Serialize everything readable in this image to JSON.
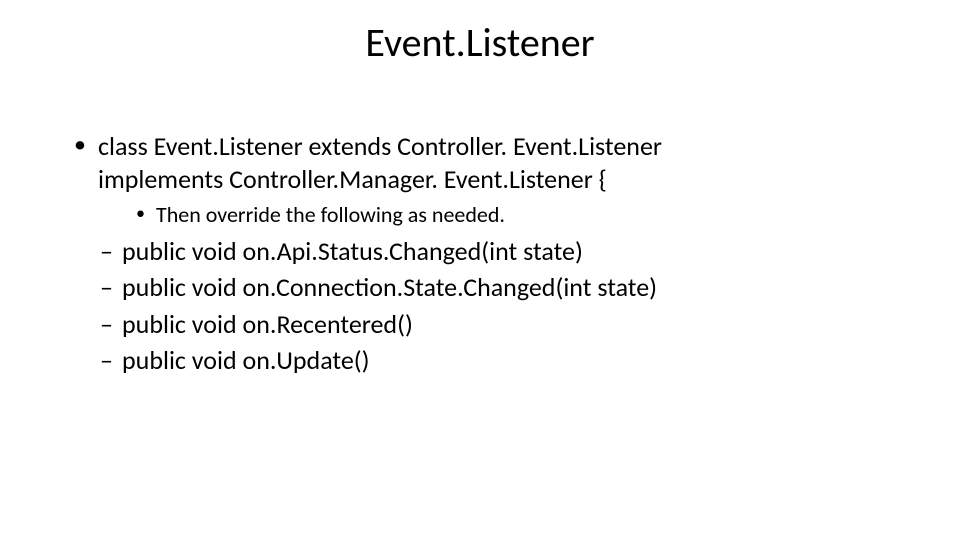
{
  "title": "Event.Listener",
  "bullet1_line1": "class Event.Listener extends Controller. Event.Listener",
  "bullet1_line2": "implements Controller.Manager. Event.Listener {",
  "sub_bullet": "Then override the following as needed.",
  "methods": [
    "public void on.Api.Status.Changed(int state)",
    "public void on.Connection.State.Changed(int state)",
    "public void on.Recentered()",
    "public void on.Update()"
  ]
}
